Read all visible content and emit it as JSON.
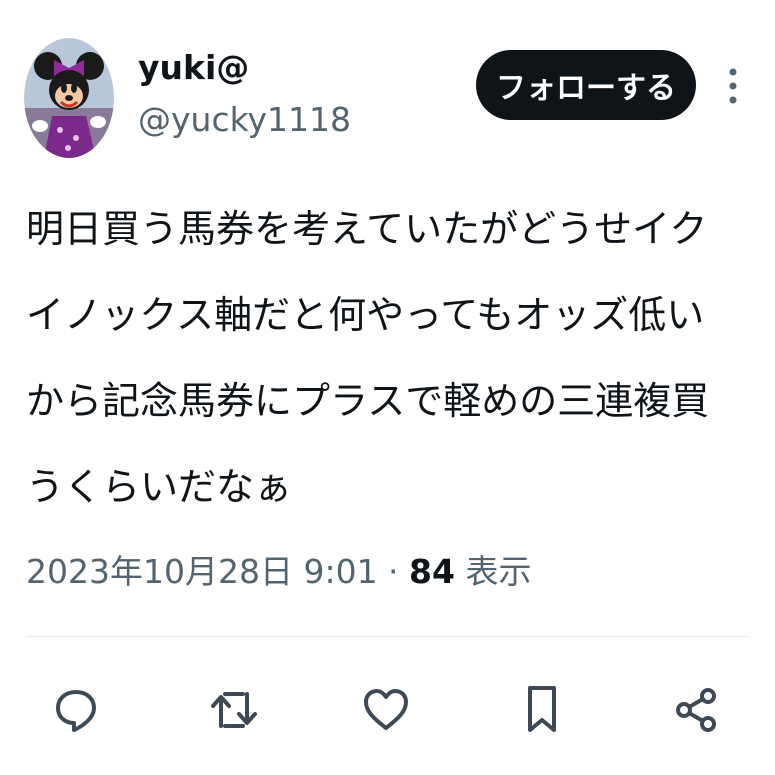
{
  "user": {
    "display_name": "yuki@",
    "handle": "@yucky1118",
    "avatar": "avatar-image"
  },
  "follow_button": {
    "label": "フォローする"
  },
  "tweet": {
    "text": "明日買う馬券を考えていたがどうせイク\nイノックス軸だと何やってもオッズ低い\nから記念馬券にプラスで軽めの三連複買\nうくらいだなぁ"
  },
  "meta": {
    "timestamp": "2023年10月28日 9:01",
    "separator": " · ",
    "views_count": "84",
    "views_label": " 表示"
  },
  "actions": {
    "icons": [
      "reply-icon",
      "retweet-icon",
      "like-icon",
      "bookmark-icon",
      "share-icon"
    ]
  },
  "colors": {
    "text": "#0f1419",
    "secondary": "#536471",
    "button_bg": "#0f1419",
    "divider": "#e3e7ea"
  }
}
